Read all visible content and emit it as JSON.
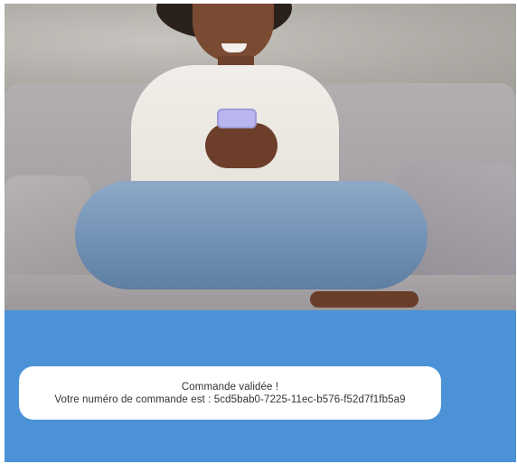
{
  "toast": {
    "title": "Commande validée !",
    "message": "Votre numéro de commande est : 5cd5bab0-7225-11ec-b576-f52d7f1fb5a9"
  },
  "colors": {
    "panel_background": "#4b93d6",
    "toast_background": "#ffffff",
    "toast_text": "#333333"
  }
}
